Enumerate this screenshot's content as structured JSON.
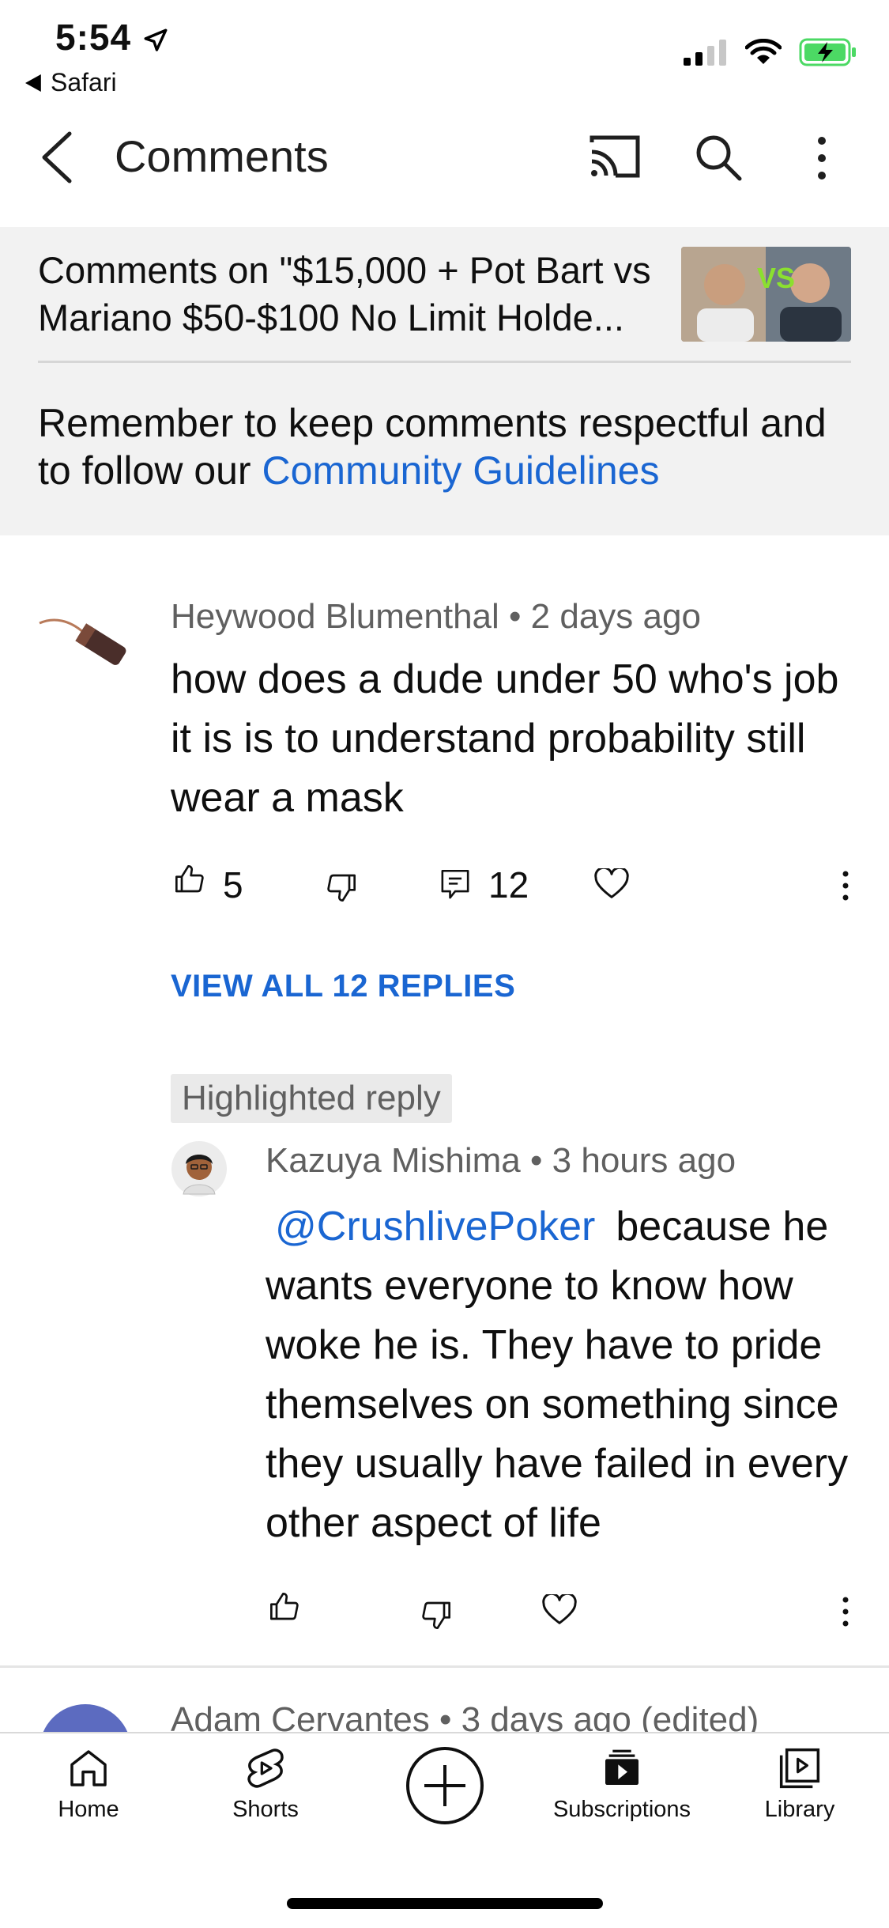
{
  "status_bar": {
    "time": "5:54",
    "back_app": "Safari"
  },
  "header": {
    "title": "Comments"
  },
  "banner": {
    "video_title": "Comments on \"$15,000 + Pot Bart vs Mariano $50-$100 No Limit Holde...",
    "thumbnail_badge": "VS",
    "note_prefix": "Remember to keep comments respectful and to follow our ",
    "note_link": "Community Guidelines"
  },
  "comment": {
    "author": "Heywood Blumenthal",
    "time": "2 days ago",
    "text": "how does a dude under 50 who's job it is is to understand probability still wear a mask",
    "likes": "5",
    "replies": "12",
    "view_replies": "VIEW ALL 12 REPLIES"
  },
  "reply": {
    "label": "Highlighted reply",
    "author": "Kazuya Mishima",
    "time": "3 hours ago",
    "mention": "@CrushlivePoker",
    "text": "because he wants everyone to know how woke he is.  They have to pride themselves on something since they usually have failed in every other aspect of life"
  },
  "next_comment": {
    "author": "Adam Cervantes",
    "time": "3 days ago (edited)"
  },
  "nav": {
    "home": "Home",
    "shorts": "Shorts",
    "subscriptions": "Subscriptions",
    "library": "Library"
  },
  "colors": {
    "link": "#1a66d2",
    "battery": "#4cd964"
  }
}
